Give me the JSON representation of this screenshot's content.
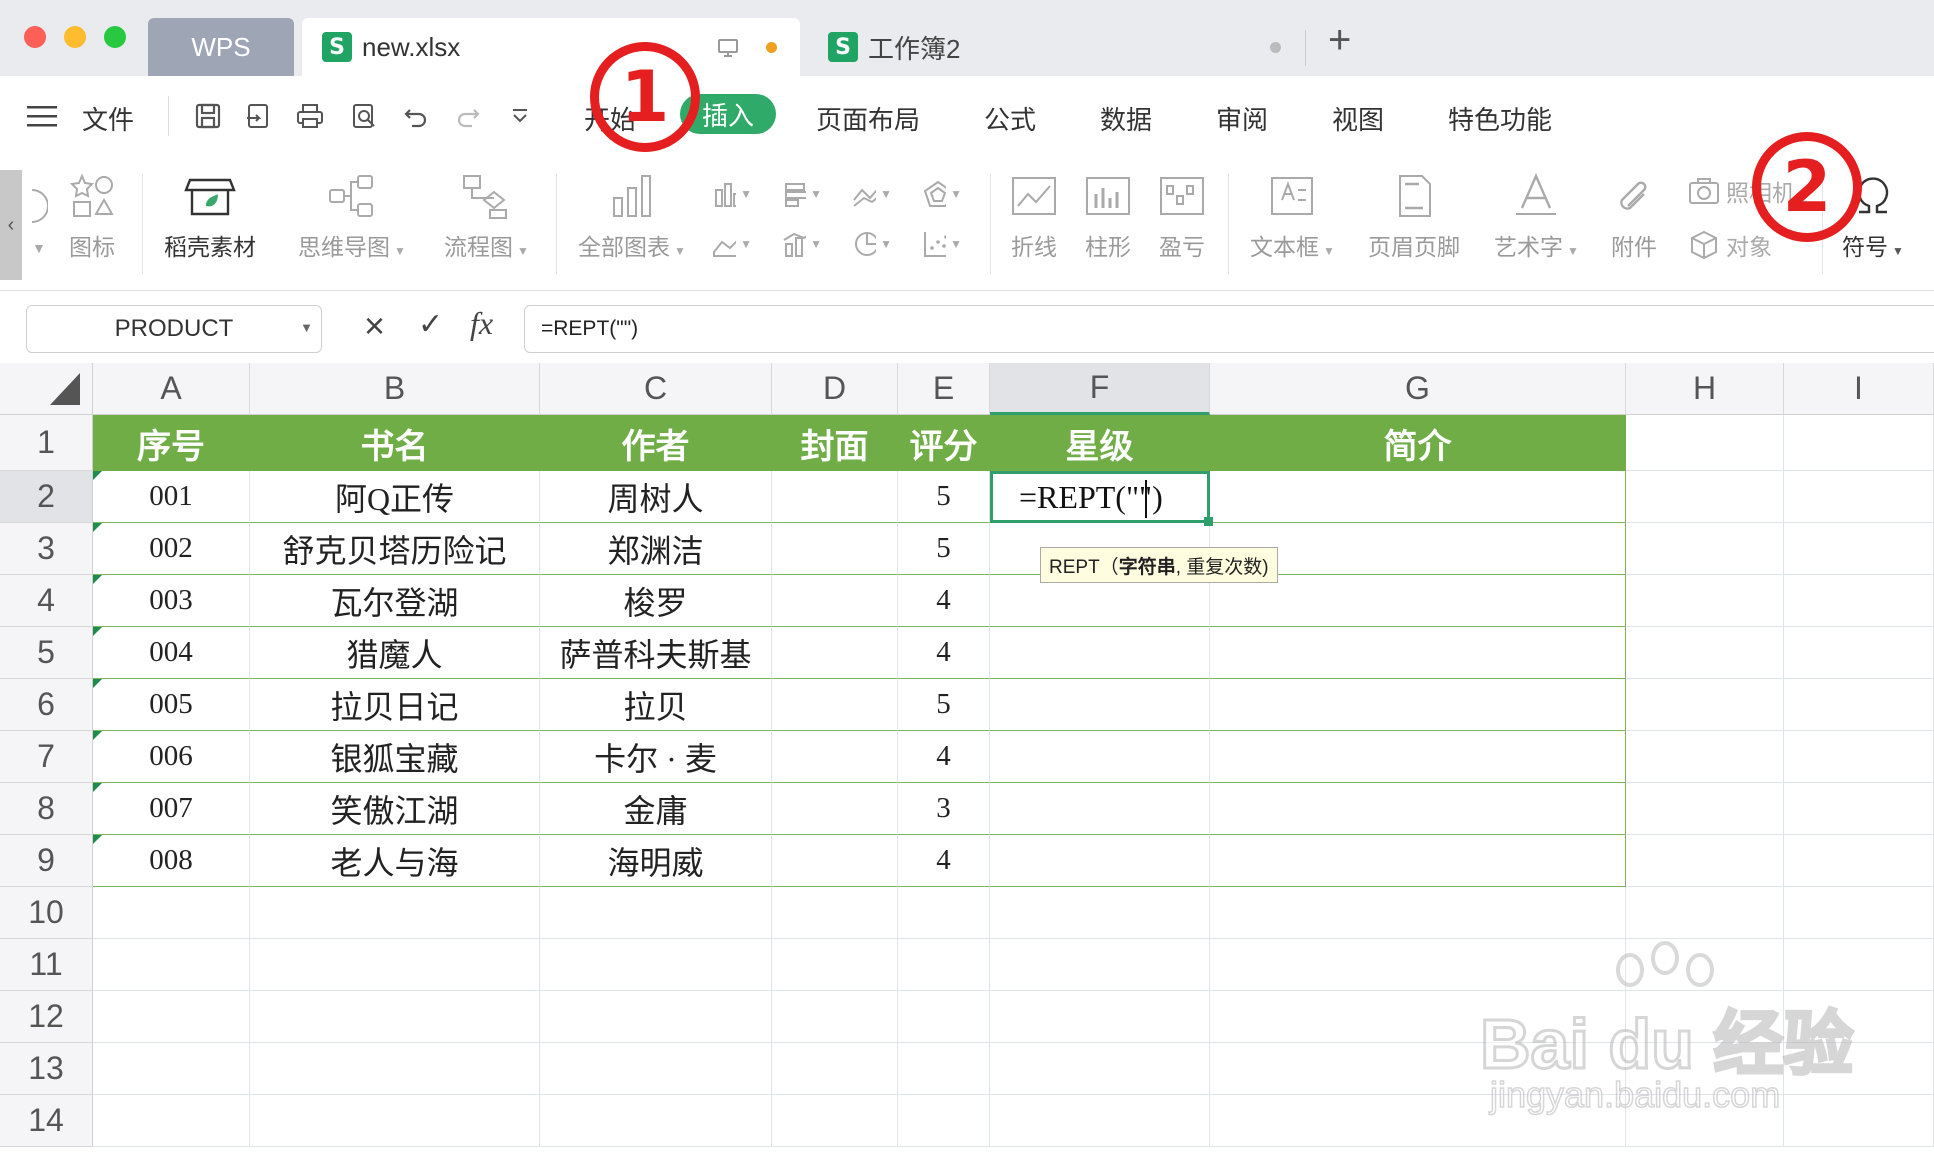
{
  "tabs": {
    "wps": "WPS",
    "active_file": "new.xlsx",
    "second_file": "工作簿2",
    "new_tab": "+"
  },
  "menu": {
    "file": "文件",
    "tabs": [
      "开始",
      "插入",
      "页面布局",
      "公式",
      "数据",
      "审阅",
      "视图",
      "特色功能"
    ],
    "active_tab": "插入"
  },
  "ribbon": {
    "items": [
      {
        "label": "图标"
      },
      {
        "label": "稻壳素材"
      },
      {
        "label": "思维导图"
      },
      {
        "label": "流程图"
      },
      {
        "label": "全部图表"
      },
      {
        "label": "折线"
      },
      {
        "label": "柱形"
      },
      {
        "label": "盈亏"
      },
      {
        "label": "文本框"
      },
      {
        "label": "页眉页脚"
      },
      {
        "label": "艺术字"
      },
      {
        "label": "附件"
      },
      {
        "label": "照相机"
      },
      {
        "label": "对象"
      },
      {
        "label": "符号"
      }
    ]
  },
  "formula_bar": {
    "name_box": "PRODUCT",
    "cancel": "×",
    "confirm": "✓",
    "fx": "fx",
    "formula": "=REPT(\"\")"
  },
  "sheet": {
    "columns": [
      "A",
      "B",
      "C",
      "D",
      "E",
      "F",
      "G",
      "H",
      "I"
    ],
    "rows": [
      "1",
      "2",
      "3",
      "4",
      "5",
      "6",
      "7",
      "8",
      "9",
      "10",
      "11",
      "12",
      "13",
      "14"
    ],
    "header": [
      "序号",
      "书名",
      "作者",
      "封面",
      "评分",
      "星级",
      "简介"
    ],
    "data": [
      [
        "001",
        "阿Q正传",
        "周树人",
        "",
        "5"
      ],
      [
        "002",
        "舒克贝塔历险记",
        "郑渊洁",
        "",
        "5"
      ],
      [
        "003",
        "瓦尔登湖",
        "梭罗",
        "",
        "4"
      ],
      [
        "004",
        "猎魔人",
        "萨普科夫斯基",
        "",
        "4"
      ],
      [
        "005",
        "拉贝日记",
        "拉贝",
        "",
        "5"
      ],
      [
        "006",
        "银狐宝藏",
        "卡尔 · 麦",
        "",
        "4"
      ],
      [
        "007",
        "笑傲江湖",
        "金庸",
        "",
        "3"
      ],
      [
        "008",
        "老人与海",
        "海明威",
        "",
        "4"
      ]
    ],
    "editing_cell_text": "=REPT(\"\")",
    "tooltip_prefix": "REPT（",
    "tooltip_bold": "字符串",
    "tooltip_suffix": ", 重复次数)"
  },
  "annotations": [
    "1",
    "2"
  ],
  "watermark": {
    "brand": "Bai du 经验",
    "url": "jingyan.baidu.com"
  },
  "colors": {
    "header_green": "#70ad47",
    "accent_green": "#2f9e6b",
    "annotation_red": "#e51f1f"
  }
}
